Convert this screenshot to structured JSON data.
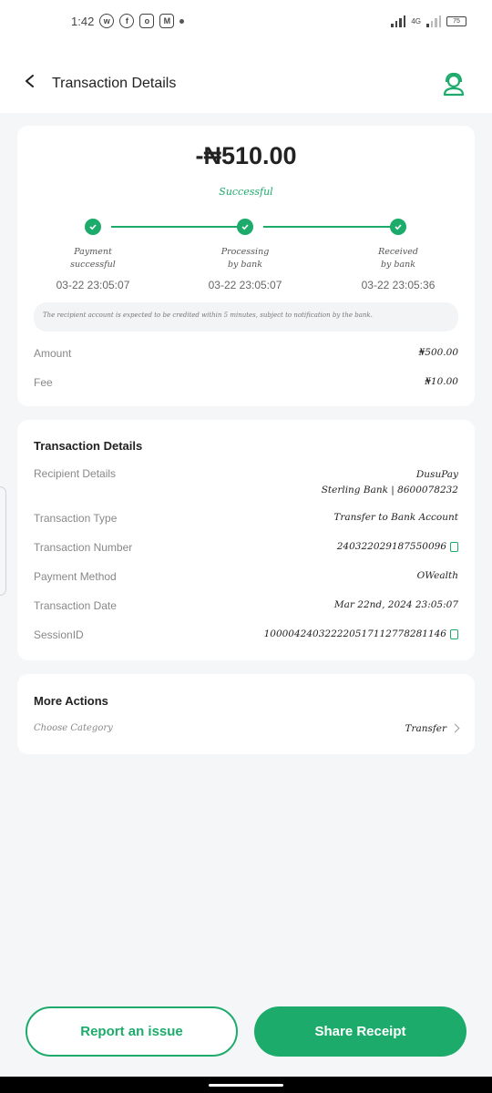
{
  "status_bar": {
    "time": "1:42",
    "network": "4G",
    "battery": "75"
  },
  "header": {
    "title": "Transaction Details"
  },
  "summary": {
    "amount": "-₦510.00",
    "status": "Successful",
    "steps": [
      {
        "line1": "Payment",
        "line2": "successful",
        "time": "03-22 23:05:07"
      },
      {
        "line1": "Processing",
        "line2": "by bank",
        "time": "03-22 23:05:07"
      },
      {
        "line1": "Received",
        "line2": "by bank",
        "time": "03-22 23:05:36"
      }
    ],
    "note": "The recipient account is expected to be credited within 5 minutes, subject to notification by the bank.",
    "amount_label": "Amount",
    "amount_value": "₦500.00",
    "fee_label": "Fee",
    "fee_value": "₦10.00"
  },
  "details": {
    "title": "Transaction Details",
    "recipient_label": "Recipient Details",
    "recipient_name": "DusuPay",
    "recipient_bank": "Sterling Bank | 8600078232",
    "type_label": "Transaction Type",
    "type_value": "Transfer to Bank Account",
    "number_label": "Transaction Number",
    "number_value": "240322029187550096",
    "method_label": "Payment Method",
    "method_value": "OWealth",
    "date_label": "Transaction Date",
    "date_value": "Mar 22nd, 2024 23:05:07",
    "session_label": "SessionID",
    "session_value": "100004240322220517112778281146"
  },
  "more_actions": {
    "title": "More Actions",
    "category_label": "Choose Category",
    "category_value": "Transfer"
  },
  "buttons": {
    "report": "Report an issue",
    "share": "Share Receipt"
  },
  "colors": {
    "accent": "#1dab6b",
    "background": "#f5f6f8"
  }
}
